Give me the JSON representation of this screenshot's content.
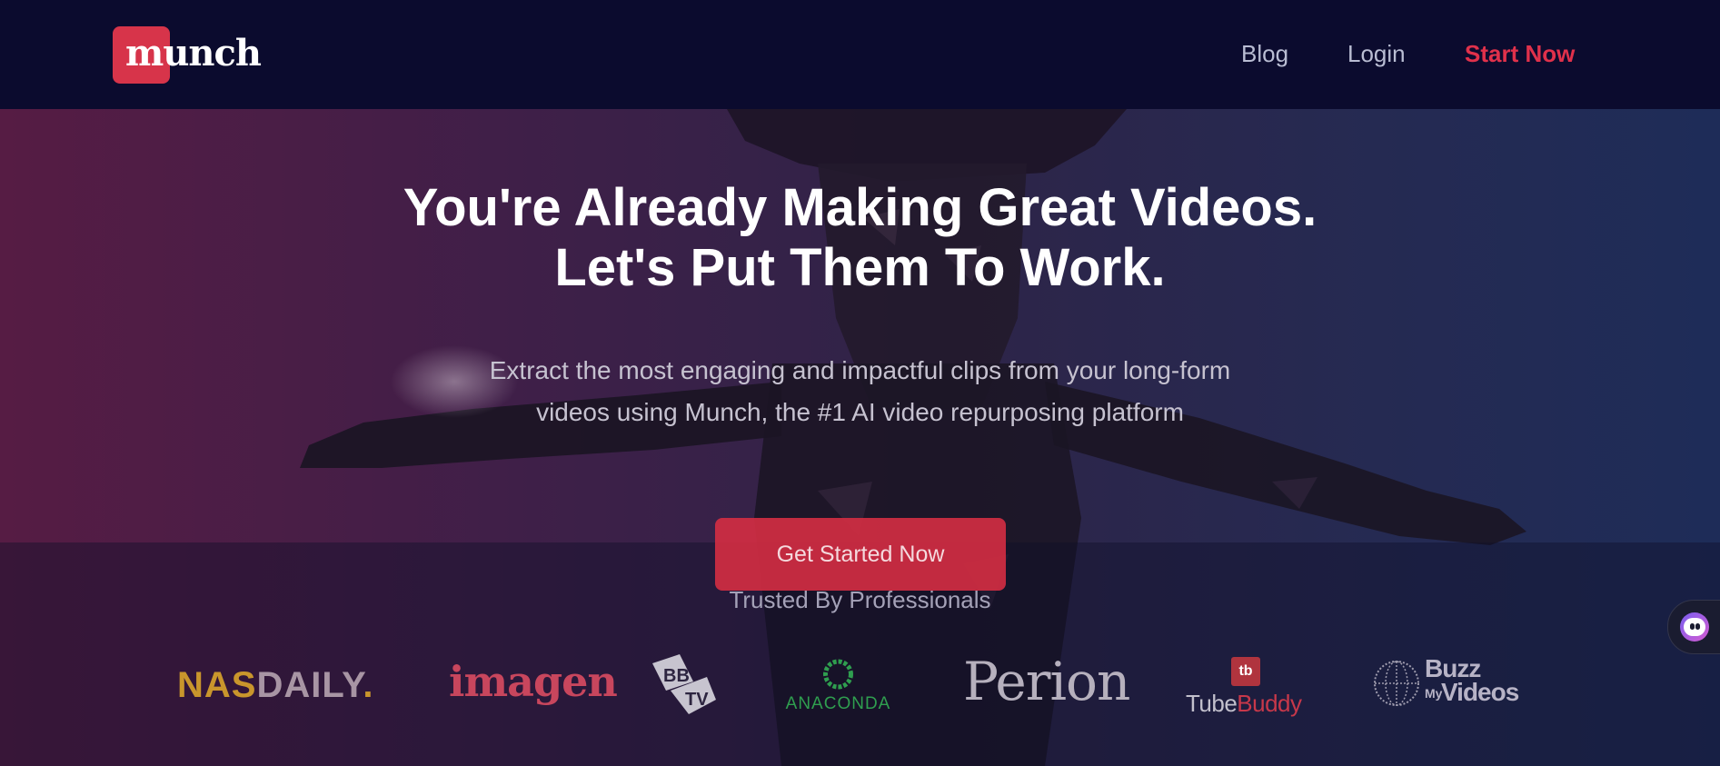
{
  "brand": {
    "name": "munch",
    "accent": "#d7344a"
  },
  "nav": {
    "links": [
      {
        "label": "Blog"
      },
      {
        "label": "Login"
      },
      {
        "label": "Start Now",
        "color": "#e0314b"
      }
    ]
  },
  "hero": {
    "headline_line1": "You're Already Making Great Videos.",
    "headline_line2": "Let's Put Them To Work.",
    "subtext_line1": "Extract the most engaging and impactful clips from your long-form",
    "subtext_line2": "videos using Munch, the #1 AI video repurposing platform",
    "cta_label": "Get Started Now",
    "cta_color": "#d52d42"
  },
  "trusted": {
    "title": "Trusted By Professionals",
    "logos": {
      "nasdaily_nas": "NAS",
      "nasdaily_daily": "DAILY",
      "nasdaily_dot": ".",
      "imagen": "imagen",
      "bbtv": "BBTV",
      "anaconda": "ANACONDA",
      "perion": "Perion",
      "tubebuddy_badge": "tb",
      "tubebuddy_tube": "Tube",
      "tubebuddy_buddy": "Buddy",
      "buzz_word": "Buzz",
      "buzz_my": "My",
      "buzz_videos": "Videos"
    }
  },
  "chat_widget": {
    "icon": "chat-bot-icon"
  }
}
